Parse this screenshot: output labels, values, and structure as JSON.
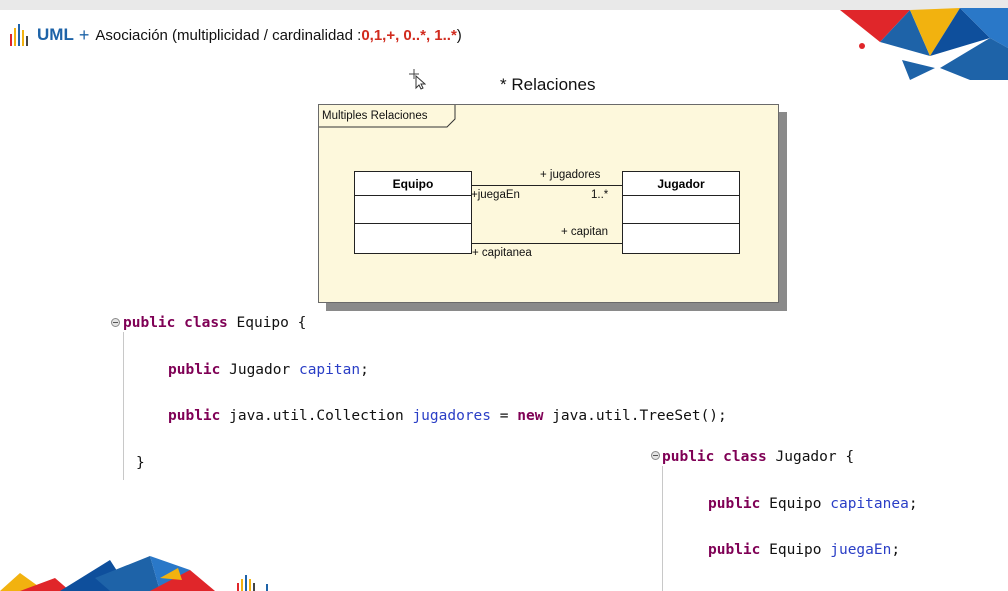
{
  "slide": {
    "title": {
      "uml": "UML",
      "plus": "+",
      "text": "Asociación  (multiplicidad / cardinalidad : ",
      "values": "0,1,+, 0..*, 1..*",
      "close": ")"
    },
    "subtitle": "* Relaciones"
  },
  "diagram": {
    "package_label": "Multiples Relaciones",
    "classes": {
      "equipo": "Equipo",
      "jugador": "Jugador"
    },
    "roles": {
      "jugadores": "+ jugadores",
      "juega_en": "+juegaEn",
      "multiplicity": "1..*",
      "capitan": "+ capitan",
      "capitanea": "+ capitanea"
    }
  },
  "code": {
    "equipo": {
      "kw_public": "public",
      "kw_class": "class",
      "class_decl": " Equipo {",
      "f1_kw": "public",
      "f1_type": " Jugador ",
      "f1_name": "capitan",
      "f1_end": ";",
      "f2_kw": "public",
      "f2_type": " java.util.Collection ",
      "f2_name": "jugadores",
      "f2_eq": " = ",
      "f2_new": "new",
      "f2_init": " java.util.TreeSet();",
      "close": "}"
    },
    "jugador": {
      "kw_public": "public",
      "kw_class": "class",
      "class_decl": " Jugador {",
      "f1_kw": "public",
      "f1_type": " Equipo ",
      "f1_name": "capitanea",
      "f1_end": ";",
      "f2_kw": "public",
      "f2_type": " Equipo ",
      "f2_name": "juegaEn",
      "f2_end": ";"
    }
  },
  "colors": {
    "keyword": "#7f0055",
    "field": "#2a3ec6",
    "title_blue": "#1e63a8",
    "title_red": "#d12b1e",
    "diagram_bg": "#fdf8dc"
  },
  "icons": [
    "logo-bars-icon",
    "mouse-cursor-icon",
    "fold-collapse-icon",
    "decorative-triangles"
  ]
}
